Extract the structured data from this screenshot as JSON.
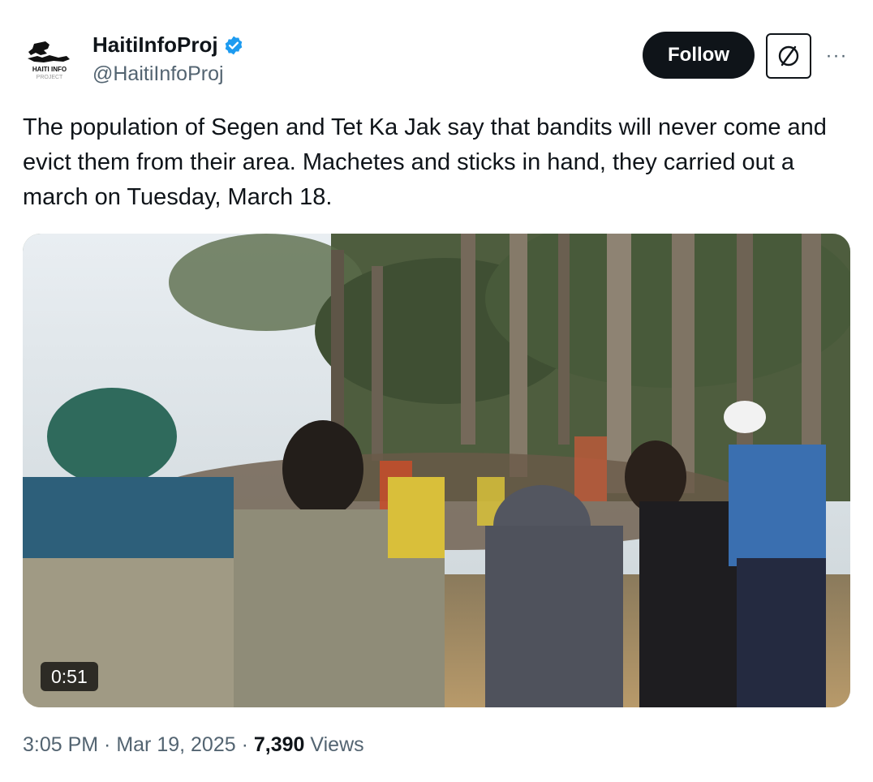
{
  "account": {
    "display_name": "HaitiInfoProj",
    "handle": "@HaitiInfoProj",
    "verified": true,
    "avatar_text_main": "HAITI INFO",
    "avatar_text_sub": "PROJECT"
  },
  "actions": {
    "follow_label": "Follow",
    "grok_icon": "grok-slash-circle-icon",
    "more_icon": "more-dots-icon",
    "more_glyph": "···"
  },
  "tweet": {
    "text": "The population of Segen and Tet Ka Jak say that bandits will never come and evict them from their area. Machetes and sticks in hand, they carried out a march on Tuesday, March 18."
  },
  "media": {
    "type": "video",
    "duration": "0:51"
  },
  "meta": {
    "time": "3:05 PM",
    "sep1": " · ",
    "date": "Mar 19, 2025",
    "sep2": " · ",
    "views_count": "7,390",
    "views_label": " Views"
  },
  "colors": {
    "primary_text": "#0f1419",
    "secondary_text": "#536471",
    "verified_blue": "#1d9bf0",
    "follow_bg": "#0f1419"
  }
}
